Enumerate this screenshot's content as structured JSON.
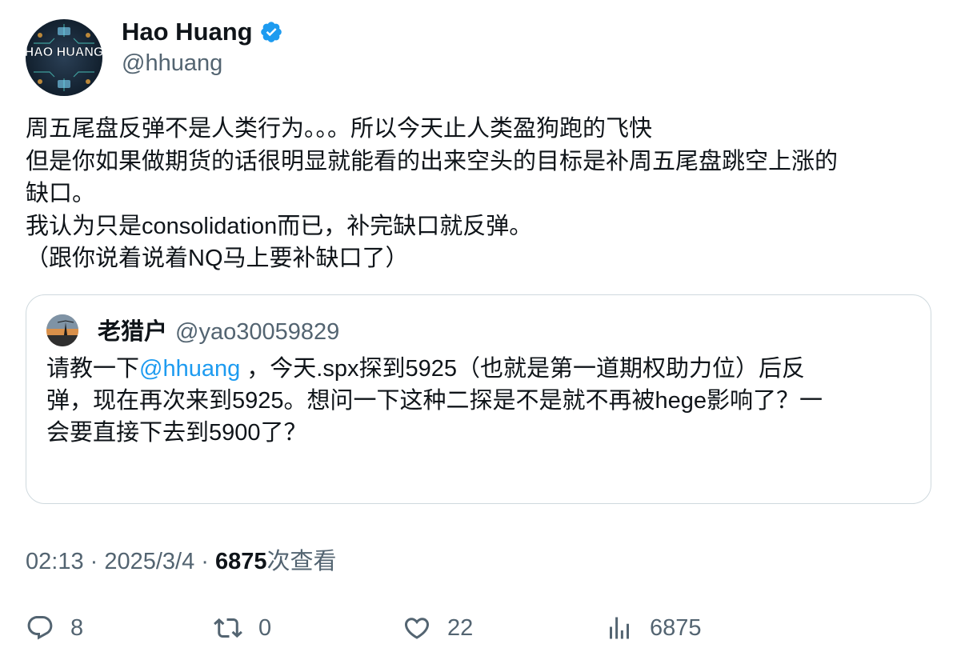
{
  "author": {
    "display_name": "Hao Huang",
    "handle": "@hhuang",
    "avatar_text": "HAO HUANG",
    "verified": true
  },
  "tweet": {
    "lines": [
      "周五尾盘反弹不是人类行为。。。所以今天止人类盈狗跑的飞快",
      "但是你如果做期货的话很明显就能看的出来空头的目标是补周五尾盘跳空上涨的",
      "缺口。",
      "我认为只是consolidation而已，补完缺口就反弹。",
      "（跟你说着说着NQ马上要补缺口了）"
    ]
  },
  "quoted": {
    "display_name": "老猎户",
    "handle": "@yao30059829",
    "line1_prefix": "请教一下",
    "mention": "@hhuang",
    "line1_suffix": " ，今天.spx探到5925（也就是第一道期权助力位）后反",
    "line2": "弹，现在再次来到5925。想问一下这种二探是不是就不再被hege影响了？一",
    "line3": "会要直接下去到5900了？"
  },
  "meta": {
    "time": "02:13",
    "separator": " · ",
    "date": "2025/3/4",
    "views_count": "6875",
    "views_label": "次查看"
  },
  "actions": {
    "replies": "8",
    "retweets": "0",
    "likes": "22",
    "views": "6875"
  },
  "colors": {
    "text": "#0f1419",
    "secondary": "#536471",
    "accent": "#1d9bf0",
    "border": "#cfd9de"
  },
  "icons": [
    "verified-badge-icon",
    "reply-icon",
    "retweet-icon",
    "like-icon",
    "views-icon"
  ]
}
